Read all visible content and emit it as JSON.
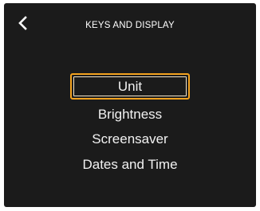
{
  "header": {
    "title": "KEYS AND DISPLAY",
    "back_icon": "chevron-left-icon"
  },
  "menu": {
    "items": [
      {
        "label": "Unit",
        "selected": true
      },
      {
        "label": "Brightness",
        "selected": false
      },
      {
        "label": "Screensaver",
        "selected": false
      },
      {
        "label": "Dates and Time",
        "selected": false
      }
    ]
  },
  "colors": {
    "background": "#1b1b1b",
    "text": "#f2f2f2",
    "selection_outline": "#f3a21f"
  }
}
